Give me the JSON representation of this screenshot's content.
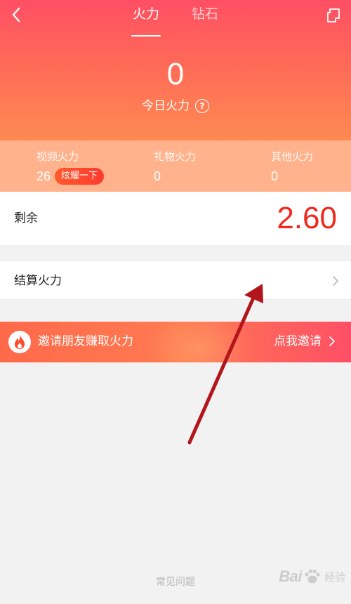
{
  "header": {
    "back_icon": "chevron-left-icon",
    "tabs": [
      {
        "label": "火力",
        "active": true
      },
      {
        "label": "钻石",
        "active": false
      }
    ],
    "corner_icon": "page-fold-icon"
  },
  "today": {
    "value": "0",
    "label": "今日火力",
    "help_icon": "question-circle-icon",
    "help_glyph": "?"
  },
  "stats": [
    {
      "label": "视频火力",
      "value": "26",
      "button": "炫耀一下"
    },
    {
      "label": "礼物火力",
      "value": "0"
    },
    {
      "label": "其他火力",
      "value": "0"
    }
  ],
  "balance": {
    "label": "剩余",
    "value": "2.60",
    "color": "#f0291f"
  },
  "settle": {
    "label": "结算火力",
    "icon": "chevron-right-icon"
  },
  "invite": {
    "icon": "flame-icon",
    "text": "邀请朋友赚取火力",
    "action": "点我邀请",
    "action_icon": "chevron-right-icon"
  },
  "footer": {
    "faq": "常见问题"
  },
  "watermark": {
    "text": "Bai",
    "sub": "经验",
    "icon": "paw-icon"
  },
  "colors": {
    "hero_top": "#ff4f64",
    "hero_bottom": "#ff8a52",
    "stats_band": "#ffb28b",
    "flaunt_button": "#ff3b2f",
    "annotation_arrow": "#b3151c"
  }
}
